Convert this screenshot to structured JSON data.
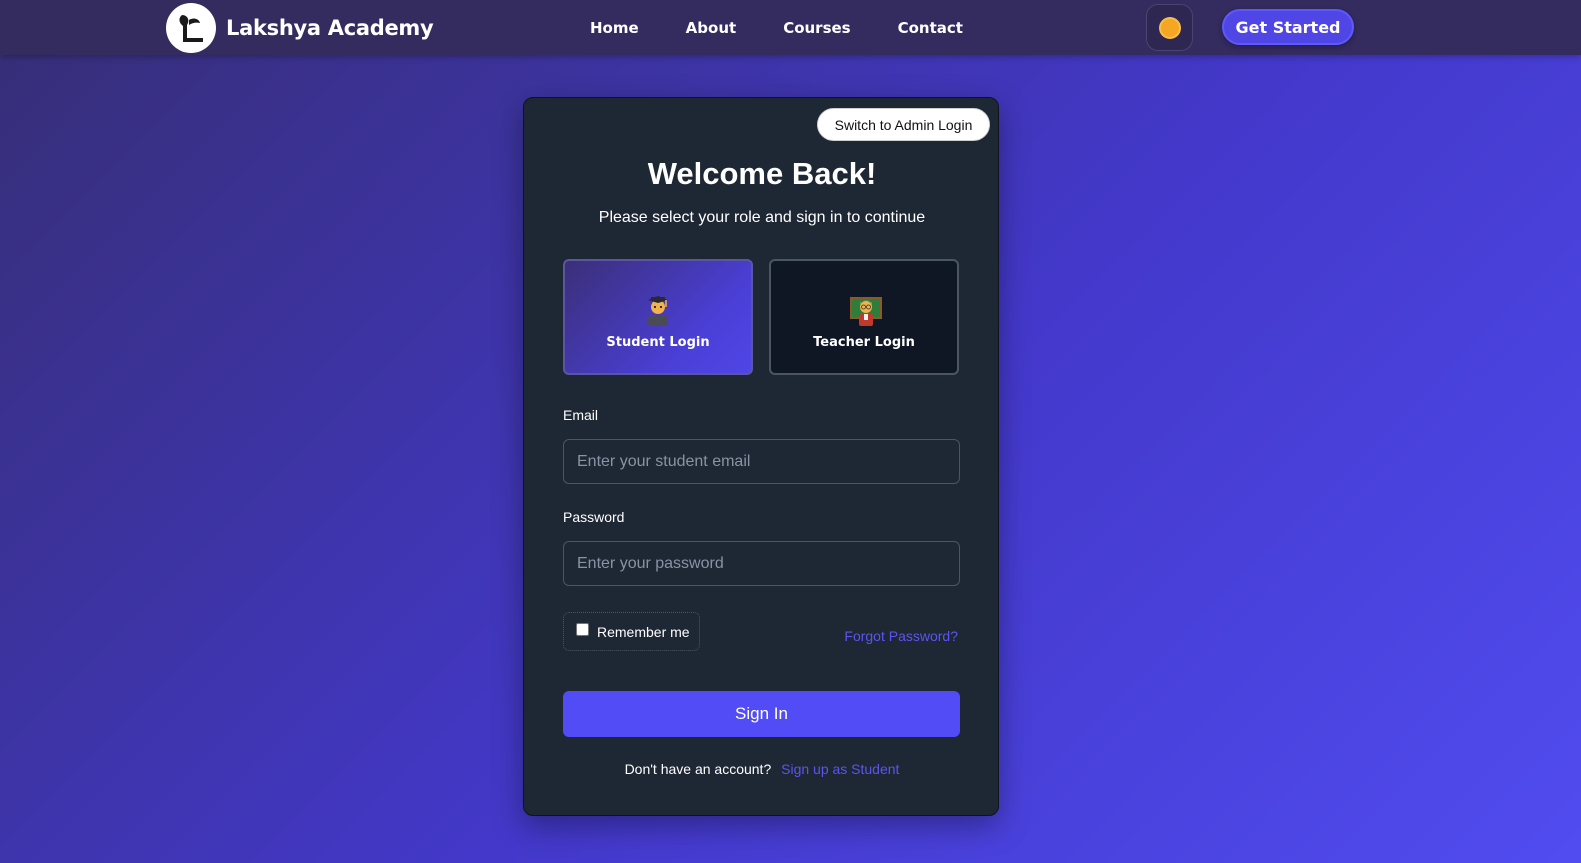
{
  "brand": {
    "name": "Lakshya Academy",
    "logo_icon": "lakshya-logo-icon"
  },
  "nav": {
    "links": [
      "Home",
      "About",
      "Courses",
      "Contact"
    ],
    "theme_toggle_icon": "sun-icon",
    "cta_label": "Get Started"
  },
  "card": {
    "admin_switch_label": "Switch to Admin Login",
    "title": "Welcome Back!",
    "subtitle": "Please select your role and sign in to continue",
    "roles": [
      {
        "label": "Student Login",
        "icon": "student-icon",
        "selected": true
      },
      {
        "label": "Teacher Login",
        "icon": "teacher-icon",
        "selected": false
      }
    ],
    "email": {
      "label": "Email",
      "placeholder": "Enter your student email",
      "value": ""
    },
    "password": {
      "label": "Password",
      "placeholder": "Enter your password",
      "value": ""
    },
    "remember_label": "Remember me",
    "remember_checked": false,
    "forgot_label": "Forgot Password?",
    "signin_label": "Sign In",
    "signup_prompt": "Don't have an account?",
    "signup_link": "Sign up as Student"
  },
  "colors": {
    "accent": "#514cf6",
    "link": "#5b55f0",
    "card_bg": "#1e2734",
    "nav_bg": "#342b5f"
  }
}
